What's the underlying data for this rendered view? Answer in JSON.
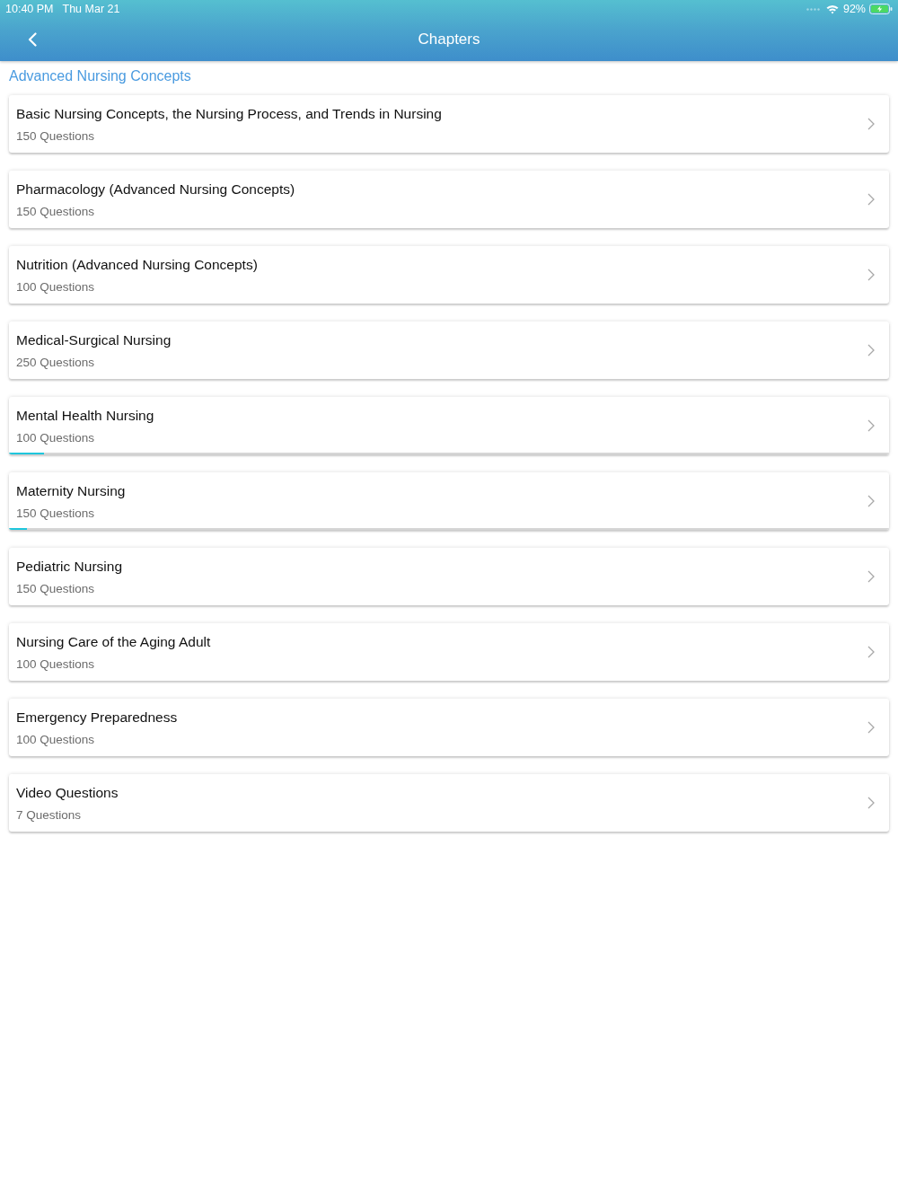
{
  "status_bar": {
    "time": "10:40 PM",
    "date": "Thu Mar 21",
    "battery": "92%"
  },
  "nav_bar": {
    "title": "Chapters"
  },
  "section": {
    "title": "Advanced Nursing Concepts"
  },
  "chapters": [
    {
      "title": "Basic Nursing Concepts, the Nursing Process, and Trends in Nursing",
      "count": "150 Questions"
    },
    {
      "title": "Pharmacology (Advanced Nursing Concepts)",
      "count": "150 Questions"
    },
    {
      "title": "Nutrition (Advanced Nursing Concepts)",
      "count": "100 Questions"
    },
    {
      "title": "Medical-Surgical Nursing",
      "count": "250 Questions"
    },
    {
      "title": "Mental Health Nursing",
      "count": "100 Questions",
      "level": 0.04
    },
    {
      "title": "Maternity Nursing",
      "count": "150 Questions",
      "level": 0.02
    },
    {
      "title": "Pediatric Nursing",
      "count": "150 Questions"
    },
    {
      "title": "Nursing Care of the Aging Adult",
      "count": "100 Questions"
    },
    {
      "title": "Emergency Preparedness",
      "count": "100 Questions"
    },
    {
      "title": "Video Questions",
      "count": "7 Questions"
    }
  ]
}
